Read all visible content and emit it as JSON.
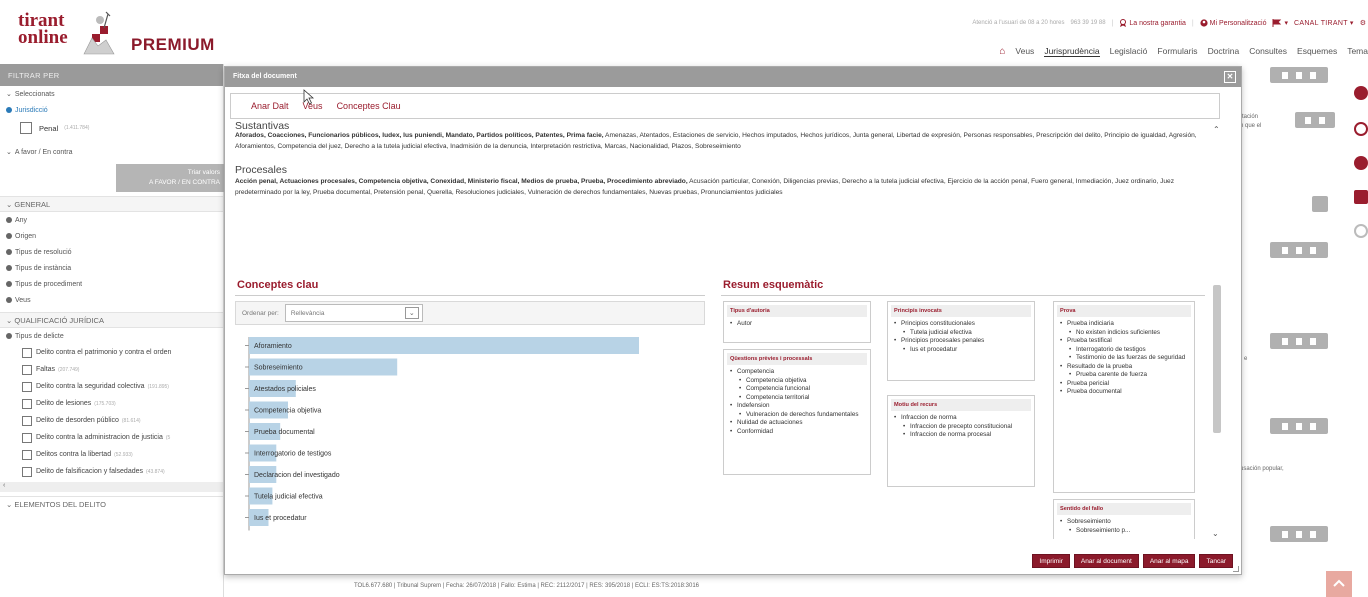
{
  "header": {
    "brand_line1": "tirant",
    "brand_line2": "online",
    "premium": "PREMIUM",
    "util_small": "Atenció a l'usuari de 08 a 20 hores",
    "phone": "963 39 19 88",
    "guarantee": "La nostra garantia",
    "personalization": "Mi Personalització",
    "canal": "CANAL TIRANT"
  },
  "nav": {
    "items": [
      "Veus",
      "Jurisprudència",
      "Legislació",
      "Formularis",
      "Doctrina",
      "Consultes",
      "Esquemes",
      "Tema"
    ],
    "active": "Jurisprudència"
  },
  "sidebar": {
    "header": "FILTRAR PER",
    "selected_label": "Seleccionats",
    "jurisdiction": "Jurisdicció",
    "penal_label": "Penal",
    "penal_count": "(1.411.784)",
    "favor_label": "A favor / En contra",
    "filter_btn_1": "Triar valors",
    "filter_btn_2": "A FAVOR / EN CONTRA",
    "general": "GENERAL",
    "general_items": [
      "Any",
      "Origen",
      "Tipus de resolució",
      "Tipus de instància",
      "Tipus de procediment",
      "Veus"
    ],
    "qualif": "QUALIFICACIÓ JURÍDICA",
    "tipus_delicte": "Tipus de delicte",
    "delicts": [
      {
        "label": "Delito contra el patrimonio y contra el orden",
        "count": ""
      },
      {
        "label": "Faltas",
        "count": "(207.749)"
      },
      {
        "label": "Delito contra la seguridad colectiva",
        "count": "(191.895)"
      },
      {
        "label": "Delito de lesiones",
        "count": "(175.703)"
      },
      {
        "label": "Delito de desorden público",
        "count": "(81.614)"
      },
      {
        "label": "Delito contra la administracion de justicia",
        "count": "(5"
      },
      {
        "label": "Delitos contra la libertad",
        "count": "(52.933)"
      },
      {
        "label": "Delito de falsificacion y falsedades",
        "count": "(43.874)"
      }
    ],
    "elements": "ELEMENTOS DEL DELITO"
  },
  "background": {
    "text1a": "rtación",
    "text1b": "n que el",
    "text2": "e",
    "text3": "usación popular,",
    "bottom_ref": "TOL6.677.680 | Tribunal Suprem | Fecha: 26/07/2018 | Fallo: Estima | REC: 2112/2017 | RES: 395/2018 | ECLI: ES:TS:2018:3016"
  },
  "modal": {
    "title": "Fitxa del document",
    "close": "✕",
    "tabs": [
      "Anar Dalt",
      "Veus",
      "Conceptes Clau"
    ],
    "substantive_title": "Sustantivas",
    "substantive_bold": "Aforados, Coacciones, Funcionarios públicos, Iudex, Ius puniendi, Mandato, Partidos políticos, Patentes, Prima facie,",
    "substantive_rest": " Amenazas, Atentados, Estaciones de servicio, Hechos imputados, Hechos jurídicos, Junta general, Libertad de expresión, Personas responsables, Prescripción del delito, Principio de igualdad, Agresión, Aforamientos, Competencia del juez, Derecho a la tutela judicial efectiva, Inadmisión de la denuncia, Interpretación restrictiva, Marcas, Nacionalidad, Plazos, Sobreseimiento",
    "procesales_title": "Procesales",
    "procesales_bold": "Acción penal, Actuaciones procesales, Competencia objetiva, Conexidad, Ministerio fiscal, Medios de prueba, Prueba, Procedimiento abreviado,",
    "procesales_rest": " Acusación particular, Conexión, Diligencias previas, Derecho a la tutela judicial efectiva, Ejercicio de la acción penal, Fuero general, Inmediación, Juez ordinario, Juez predeterminado por la ley, Prueba documental, Pretensión penal, Querella, Resoluciones judiciales, Vulneración de derechos fundamentales, Nuevas pruebas, Pronunciamientos judiciales",
    "conceptes_title": "Conceptes clau",
    "ordenar_label": "Ordenar per:",
    "ordenar_value": "Rellevància",
    "resum_title": "Resum esquemàtic",
    "footer_buttons": [
      "Imprimir",
      "Anar al document",
      "Anar al mapa",
      "Tancar"
    ]
  },
  "schema": {
    "autoria": {
      "title": "Tipus d'autoria",
      "items": [
        "Autor"
      ]
    },
    "questions": {
      "title": "Qüestions prèvies i processals",
      "items": [
        {
          "t": "Competencia",
          "l": 1
        },
        {
          "t": "Competencia objetiva",
          "l": 2
        },
        {
          "t": "Competencia funcional",
          "l": 2
        },
        {
          "t": "Competencia territorial",
          "l": 2
        },
        {
          "t": "Indefension",
          "l": 1
        },
        {
          "t": "Vulneracion de derechos fundamentales",
          "l": 2
        },
        {
          "t": "Nulidad de actuaciones",
          "l": 1
        },
        {
          "t": "Conformidad",
          "l": 1
        }
      ]
    },
    "principis": {
      "title": "Principis invocats",
      "items": [
        {
          "t": "Principios constitucionales",
          "l": 1
        },
        {
          "t": "Tutela judicial efectiva",
          "l": 2
        },
        {
          "t": "Principios procesales penales",
          "l": 1
        },
        {
          "t": "Ius et procedatur",
          "l": 2
        }
      ]
    },
    "motiu": {
      "title": "Motiu del recurs",
      "items": [
        {
          "t": "Infraccion de norma",
          "l": 1
        },
        {
          "t": "Infraccion de precepto constitucional",
          "l": 2
        },
        {
          "t": "Infraccion de norma procesal",
          "l": 2
        }
      ]
    },
    "prova": {
      "title": "Prova",
      "items": [
        {
          "t": "Prueba indiciaria",
          "l": 1
        },
        {
          "t": "No existen indicios suficientes",
          "l": 2
        },
        {
          "t": "Prueba testifical",
          "l": 1
        },
        {
          "t": "Interrogatorio de testigos",
          "l": 2
        },
        {
          "t": "Testimonio de las fuerzas de seguridad",
          "l": 2
        },
        {
          "t": "Resultado de la prueba",
          "l": 1
        },
        {
          "t": "Prueba carente de fuerza",
          "l": 2
        },
        {
          "t": "Prueba pericial",
          "l": 1
        },
        {
          "t": "Prueba documental",
          "l": 1
        }
      ]
    },
    "sentit": {
      "title": "Sentido del fallo",
      "items": [
        {
          "t": "Sobreseimiento",
          "l": 1
        },
        {
          "t": "Sobreseimiento p...",
          "l": 2
        }
      ]
    }
  },
  "chart_data": {
    "type": "bar",
    "orientation": "horizontal",
    "categories": [
      "Aforamiento",
      "Sobreseimiento",
      "Atestados policiales",
      "Competencia objetiva",
      "Prueba documental",
      "Interrogatorio de testigos",
      "Declaracion del investigado",
      "Tutela judicial efectiva",
      "Ius et procedatur"
    ],
    "values": [
      100,
      38,
      12,
      10,
      8,
      7,
      7,
      6,
      5
    ],
    "colors": {
      "bar": "#b8d3e6",
      "axis": "#999999"
    }
  },
  "colors": {
    "brand": "#9a1d2e",
    "header_gray": "#9a9a9a",
    "button": "#8b1a2b"
  }
}
